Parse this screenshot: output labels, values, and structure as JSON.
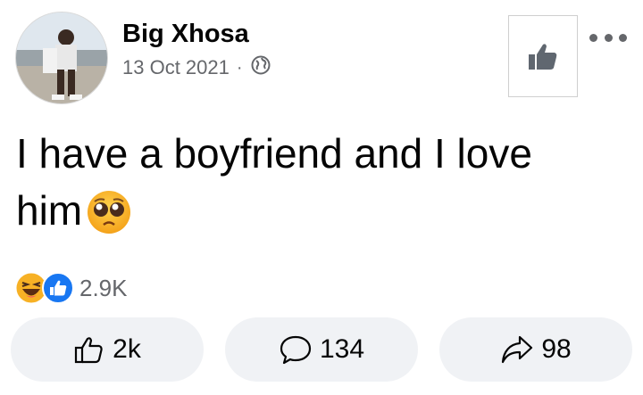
{
  "post": {
    "author": "Big Xhosa",
    "date": "13 Oct 2021",
    "separator": "·",
    "privacy_icon": "globe-icon",
    "text_line1": "I have a boyfriend and I love",
    "text_line2": "him",
    "text_emoji": "pleading-face-emoji"
  },
  "reactions": {
    "icons": [
      "laughing-face-icon",
      "like-reaction-icon"
    ],
    "count": "2.9K"
  },
  "actions": {
    "like_count": "2k",
    "comment_count": "134",
    "share_count": "98"
  },
  "colors": {
    "secondary_text": "#65676b",
    "button_bg": "#f0f2f5",
    "like_blue": "#1877f2",
    "haha_yellow": "#f7b125"
  }
}
